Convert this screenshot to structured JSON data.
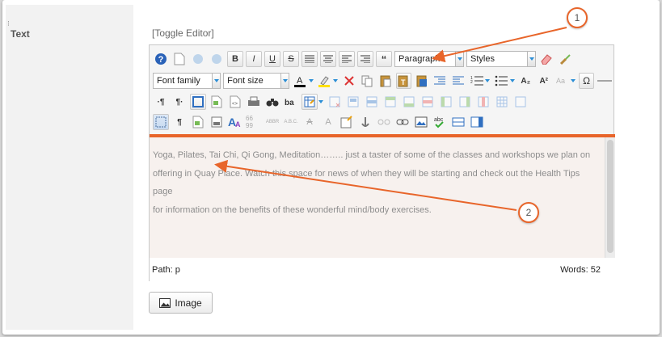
{
  "field_label": "Text",
  "toggle_editor": "[Toggle Editor]",
  "toolbar": {
    "row1": {
      "format_value": "Paragraph",
      "styles_value": "Styles",
      "bold": "B",
      "italic": "I",
      "underline": "U",
      "strike": "S",
      "blockquote": "“"
    },
    "row2": {
      "font_family": "Font family",
      "font_size": "Font size",
      "subscript": "A₂",
      "superscript": "A²",
      "omega": "Ω"
    },
    "row3": {
      "ltr": "·¶",
      "rtl": "¶·"
    },
    "row4": {
      "pilcrow": "¶",
      "cite": "66 99",
      "abbr": "ABBR",
      "acronym": "A.B.C.",
      "del": "A",
      "ins": "A"
    }
  },
  "content": {
    "line1": "Yoga, Pilates, Tai Chi, Qi Gong, Meditation…….. just a taster of some of the classes and workshops we plan on",
    "line2": "offering in Quay Place. Watch this space for news of when they will be starting and check out the Health Tips page",
    "line3": "for information on the benefits of these wonderful mind/body exercises."
  },
  "status": {
    "path_label": "Path:  p",
    "words_label": "Words: 52"
  },
  "image_button": "Image",
  "callouts": [
    "1",
    "2"
  ],
  "colors": {
    "accent": "#e8652a",
    "content_bg": "#f7f1ee"
  }
}
